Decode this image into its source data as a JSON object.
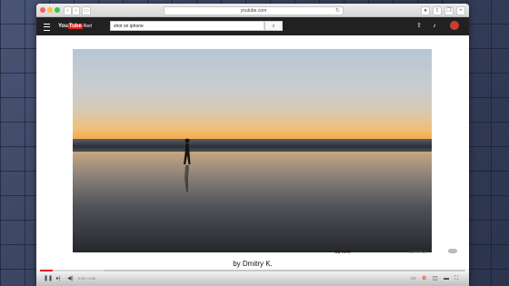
{
  "browser": {
    "url": "youtube.com",
    "back_label": "‹",
    "forward_label": "›",
    "sidebar_label": "▭"
  },
  "youtube": {
    "logo_you": "You",
    "logo_tube": "Tube",
    "logo_suffix": "Red",
    "search_value": "shot on iphone",
    "search_icon": "search-icon",
    "menu_icon": "hamburger-icon",
    "upload_icon": "upload-icon",
    "notifications_icon": "bell-icon"
  },
  "video": {
    "caption": "by Dmitry K.",
    "time": "0:00 / 1:08",
    "progress": 0.03,
    "buffered": 0.15,
    "scene": {
      "description_colors": {
        "sky_top": "#b7c5d4",
        "horizon": "#f6a94d",
        "sand_dark": "#25272d"
      }
    }
  },
  "sidebar": {
    "up_next": "Up next",
    "autoplay": "AUTOPLAY"
  },
  "colors": {
    "accent": "#e62117",
    "topbar": "#212121"
  }
}
